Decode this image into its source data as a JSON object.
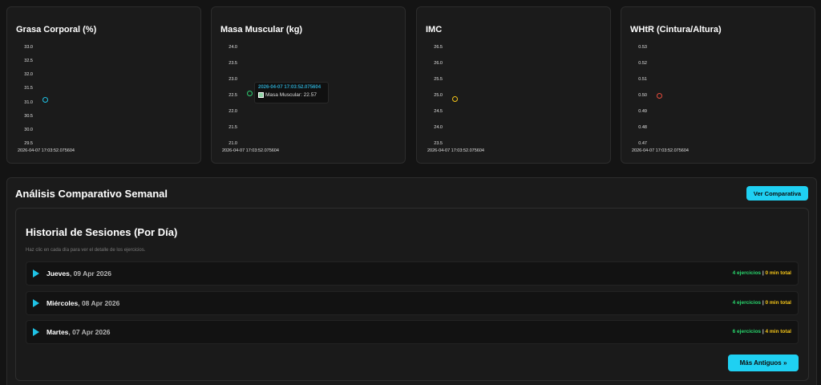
{
  "cards": [
    {
      "title": "Grasa Corporal (%)",
      "ticks": [
        "33.0",
        "32.5",
        "32.0",
        "31.5",
        "31.0",
        "30.5",
        "30.0",
        "29.5"
      ],
      "x_label": "2026-04-07 17:03:52.075604",
      "point_value": 31.1,
      "y_range": [
        29.5,
        33.0
      ],
      "point_color": "#1fc3e6"
    },
    {
      "title": "Masa Muscular (kg)",
      "ticks": [
        "24.0",
        "23.5",
        "23.0",
        "22.5",
        "22.0",
        "21.5",
        "21.0"
      ],
      "x_label": "2026-04-07 17:03:52.075604",
      "point_value": 22.57,
      "y_range": [
        21.0,
        24.0
      ],
      "point_color": "#2ecc71",
      "tooltip": {
        "title": "2026-04-07 17:03:52.075604",
        "label": "Masa Muscular: 22.57"
      }
    },
    {
      "title": "IMC",
      "ticks": [
        "26.5",
        "26.0",
        "25.5",
        "25.0",
        "24.5",
        "24.0",
        "23.5"
      ],
      "x_label": "2026-04-07 17:03:52.075604",
      "point_value": 24.9,
      "y_range": [
        23.5,
        26.5
      ],
      "point_color": "#f5c518"
    },
    {
      "title": "WHtR (Cintura/Altura)",
      "ticks": [
        "0.53",
        "0.52",
        "0.51",
        "0.50",
        "0.49",
        "0.48",
        "0.47"
      ],
      "x_label": "2026-04-07 17:03:52.075604",
      "point_value": 0.5,
      "y_range": [
        0.47,
        0.53
      ],
      "point_color": "#e74c3c"
    }
  ],
  "section": {
    "title": "Análisis Comparativo Semanal",
    "compare_button": "Ver Comparativa"
  },
  "history": {
    "title": "Historial de Sesiones (Por Día)",
    "subtitle": "Haz clic en cada día para ver el detalle de los ejercicios.",
    "rows": [
      {
        "day": "Jueves",
        "date": ", 09 Apr 2026",
        "exercises": "4 ejercicios",
        "separator": " | ",
        "minutes": "0 min total"
      },
      {
        "day": "Miércoles",
        "date": ", 08 Apr 2026",
        "exercises": "4 ejercicios",
        "separator": " | ",
        "minutes": "0 min total"
      },
      {
        "day": "Martes",
        "date": ", 07 Apr 2026",
        "exercises": "6 ejercicios",
        "separator": " | ",
        "minutes": "4 min total"
      }
    ],
    "older_button": "Más Antiguos »"
  }
}
